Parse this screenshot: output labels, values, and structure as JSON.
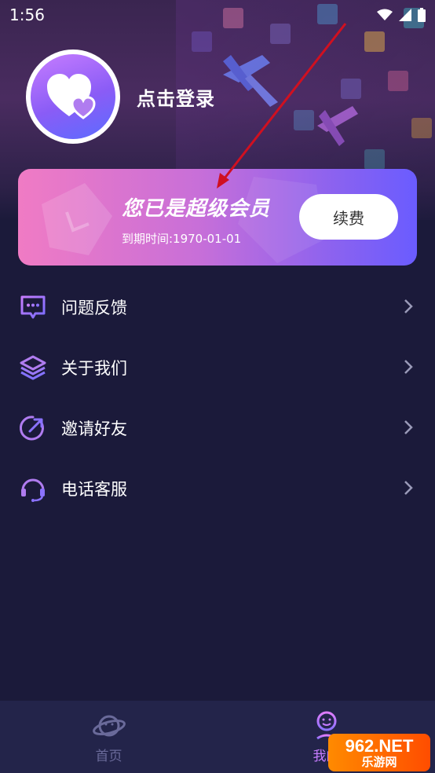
{
  "status_bar": {
    "time": "1:56"
  },
  "profile": {
    "login_text": "点击登录"
  },
  "vip_card": {
    "title": "您已是超级会员",
    "expire_text": "到期时间:1970-01-01",
    "renew_label": "续费"
  },
  "menu": {
    "items": [
      {
        "label": "问题反馈",
        "icon": "chat-bubble-icon"
      },
      {
        "label": "关于我们",
        "icon": "layers-icon"
      },
      {
        "label": "邀请好友",
        "icon": "share-arrow-icon"
      },
      {
        "label": "电话客服",
        "icon": "headset-icon"
      }
    ]
  },
  "tabbar": {
    "items": [
      {
        "label": "首页",
        "icon": "planet-icon",
        "active": false
      },
      {
        "label": "我的",
        "icon": "person-icon",
        "active": true
      }
    ]
  },
  "watermark": {
    "top": "962.NET",
    "bottom": "乐游网"
  },
  "colors": {
    "background": "#1b1a3a",
    "accent_purple": "#8a5cf6",
    "accent_pink": "#f07bc4",
    "tab_active": "#c77dff",
    "tab_inactive": "#6a6a9a",
    "arrow_red": "#d01020"
  }
}
